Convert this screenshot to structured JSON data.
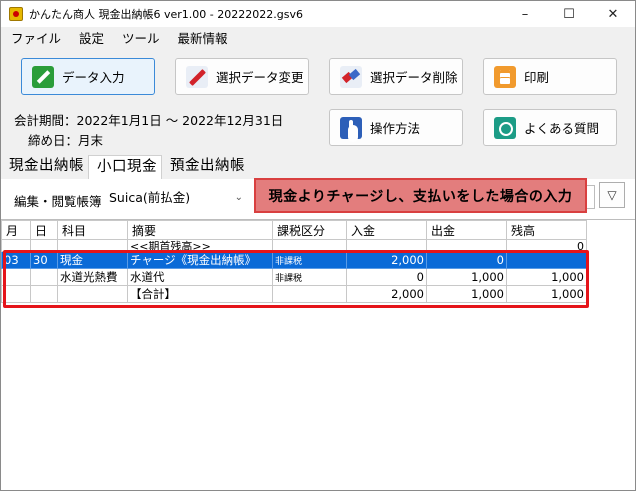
{
  "window": {
    "title": "かんたん商人 現金出納帳6 ver1.00 - 20222022.gsv6",
    "controls": [
      "–",
      "☐",
      "✕"
    ]
  },
  "menu": [
    "ファイル",
    "設定",
    "ツール",
    "最新情報"
  ],
  "toolbar": {
    "data_input": "データ入力",
    "edit_selected": "選択データ変更",
    "delete_selected": "選択データ削除",
    "print": "印刷",
    "how_to": "操作方法",
    "faq": "よくある質問"
  },
  "period": {
    "label": "会計期間：2022年1月1日 〜 2022年12月31日",
    "closing": "締め日：月末"
  },
  "tabs": [
    "現金出納帳",
    "小口現金",
    "預金出納帳"
  ],
  "active_tab": "小口現金",
  "filter": {
    "label": "編集・閲覧帳簿",
    "selected": "Suica(前払金)",
    "button": "▽"
  },
  "callout": "現金よりチャージし、支払いをした場合の入力",
  "table": {
    "headers": [
      "月",
      "日",
      "科目",
      "摘要",
      "課税区分",
      "入金",
      "出金",
      "残高"
    ],
    "opening_row": {
      "summary": "<<期首残高>>",
      "balance": "0"
    },
    "rows": [
      {
        "month": "03",
        "day": "30",
        "account": "現金",
        "summary": "チャージ《現金出納帳》",
        "tax": "非課税",
        "in": "2,000",
        "out": "0",
        "balance": ""
      },
      {
        "month": "",
        "day": "",
        "account": "水道光熱費",
        "summary": "水道代",
        "tax": "非課税",
        "in": "0",
        "out": "1,000",
        "balance": "1,000"
      },
      {
        "month": "",
        "day": "",
        "account": "",
        "summary": "【合計】",
        "tax": "",
        "in": "2,000",
        "out": "1,000",
        "balance": "1,000"
      }
    ]
  },
  "colors": {
    "selection": "#0a6ad7",
    "highlight_border": "#e5141a",
    "callout_bg": "#e37d7d"
  }
}
